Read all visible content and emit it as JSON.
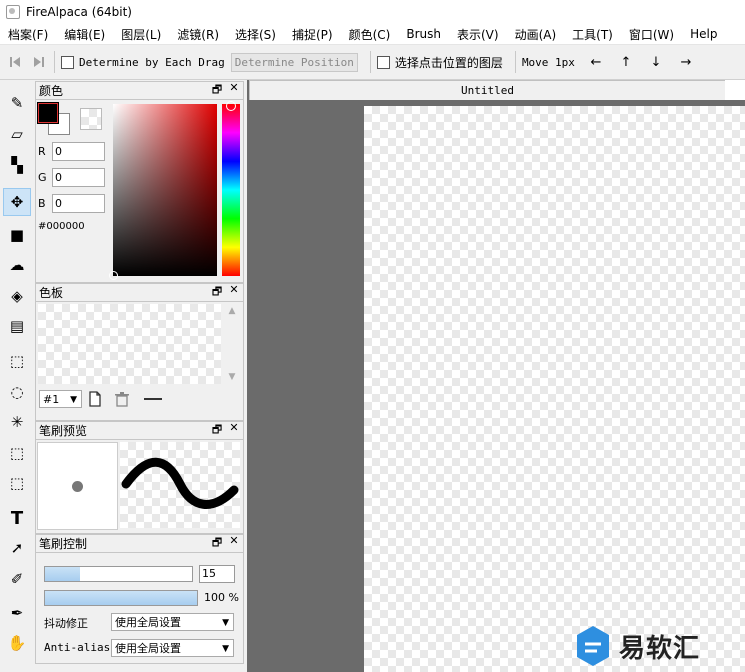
{
  "window": {
    "title": "FireAlpaca (64bit)"
  },
  "menu": [
    "档案(F)",
    "编辑(E)",
    "图层(L)",
    "滤镜(R)",
    "选择(S)",
    "捕捉(P)",
    "颜色(C)",
    "Brush",
    "表示(V)",
    "动画(A)",
    "工具(T)",
    "窗口(W)",
    "Help"
  ],
  "options": {
    "determine_each_drag": "Determine by Each Drag",
    "determine_position": "Determine Position",
    "select_layer_at_click": "选择点击位置的图层",
    "move_step": "Move 1px",
    "arrows": [
      "←",
      "↑",
      "↓",
      "→"
    ]
  },
  "tools": [
    {
      "name": "brush-tool-icon",
      "glyph": "✎",
      "selected": false
    },
    {
      "name": "eraser-tool-icon",
      "glyph": "▱",
      "selected": false
    },
    {
      "name": "dot-tool-icon",
      "glyph": "▚",
      "selected": false
    },
    {
      "name": "move-tool-icon",
      "glyph": "✥",
      "selected": true
    },
    {
      "name": "fill-rect-tool-icon",
      "glyph": "■",
      "selected": false
    },
    {
      "name": "lasso-fill-tool-icon",
      "glyph": "☁",
      "selected": false
    },
    {
      "name": "bucket-tool-icon",
      "glyph": "◈",
      "selected": false
    },
    {
      "name": "gradient-tool-icon",
      "glyph": "▤",
      "selected": false
    },
    {
      "name": "select-rect-tool-icon",
      "glyph": "⬚",
      "selected": false
    },
    {
      "name": "lasso-select-tool-icon",
      "glyph": "◌",
      "selected": false
    },
    {
      "name": "magic-wand-tool-icon",
      "glyph": "✳",
      "selected": false
    },
    {
      "name": "select-pen-tool-icon",
      "glyph": "⬚",
      "selected": false
    },
    {
      "name": "select-eraser-tool-icon",
      "glyph": "⬚",
      "selected": false
    },
    {
      "name": "text-tool-icon",
      "glyph": "T",
      "selected": false
    },
    {
      "name": "operation-tool-icon",
      "glyph": "➚",
      "selected": false
    },
    {
      "name": "divide-tool-icon",
      "glyph": "✐",
      "selected": false
    },
    {
      "name": "eyedropper-tool-icon",
      "glyph": "✒",
      "selected": false
    },
    {
      "name": "hand-tool-icon",
      "glyph": "✋",
      "selected": false
    }
  ],
  "color_panel": {
    "title": "颜色",
    "r_label": "R",
    "g_label": "G",
    "b_label": "B",
    "r": "0",
    "g": "0",
    "b": "0",
    "hex": "#000000",
    "fg_color": "#000000"
  },
  "palette_panel": {
    "title": "色板",
    "selector": "#1"
  },
  "brush_preview_panel": {
    "title": "笔刷预览"
  },
  "brush_control_panel": {
    "title": "笔刷控制",
    "size": "15",
    "size_fraction": 0.24,
    "opacity": "100 %",
    "opacity_fraction": 1.0,
    "stabilizer_label": "抖动修正",
    "stabilizer_value": "使用全局设置",
    "antialias_label": "Anti-alias",
    "antialias_value": "使用全局设置"
  },
  "panel_buttons": {
    "float": "🗗",
    "close": "✕"
  },
  "canvas": {
    "tab_title": "Untitled"
  },
  "watermark": {
    "text": "易软汇"
  }
}
